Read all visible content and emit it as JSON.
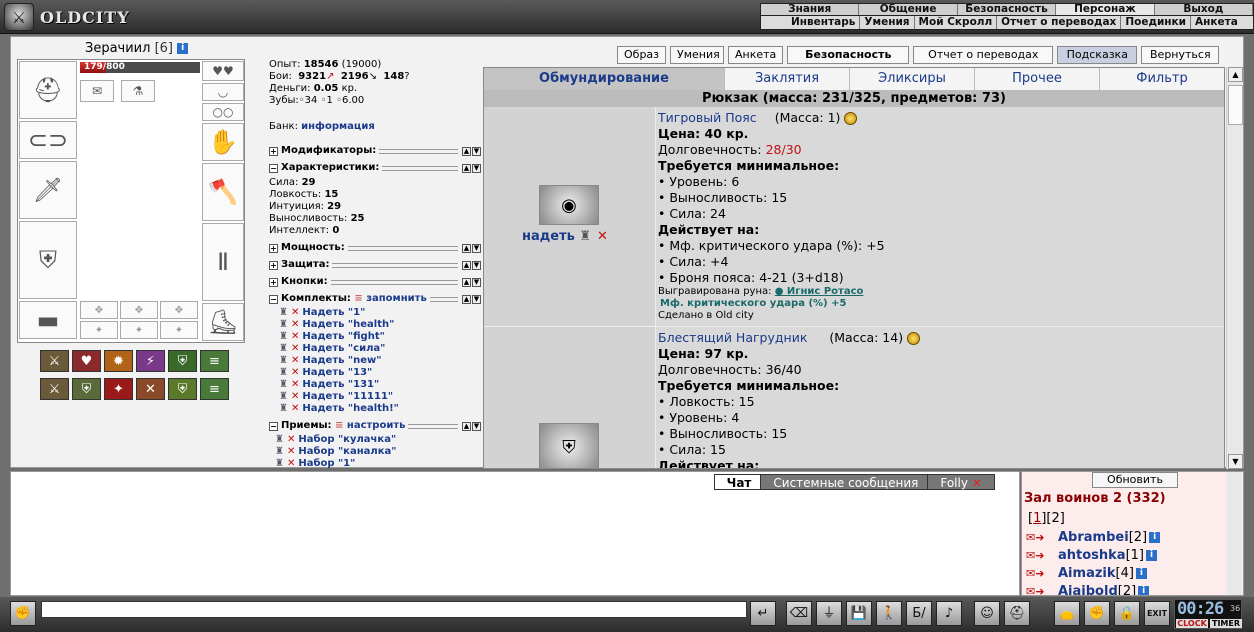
{
  "header": {
    "logo_text": "OLDCITY",
    "menu_main": [
      "Знания",
      "Общение",
      "Безопасность",
      "Персонаж",
      "Выход"
    ],
    "menu_sub": [
      "Инвентарь",
      "Умения",
      "Мой Скролл",
      "Отчет о переводах",
      "Поединки",
      "Анкета"
    ]
  },
  "character": {
    "name": "Зерачиил",
    "level": "[6]",
    "hp": "179/800",
    "hp_fraction": 0.22
  },
  "stats": {
    "exp_label": "Опыт:",
    "exp_value": "18546",
    "exp_next": "(19000)",
    "fights_label": "Бои:",
    "fights_won": "9321",
    "fights_lost": "2196",
    "fights_draw": "148",
    "money_label": "Деньги:",
    "money_value": "0.05",
    "money_unit": "кр.",
    "teeth_label": "Зубы:",
    "teeth_a": "34",
    "teeth_b": "1",
    "teeth_c": "6.00",
    "bank_label": "Банк:",
    "bank_link": "информация",
    "sec_modifiers": "Модификаторы:",
    "sec_characteristics": "Характеристики:",
    "strength_label": "Сила:",
    "strength": "29",
    "agility_label": "Ловкость:",
    "agility": "15",
    "intuition_label": "Интуиция:",
    "intuition": "29",
    "stamina_label": "Выносливость:",
    "stamina": "25",
    "intellect_label": "Интеллект:",
    "intellect": "0",
    "sec_power": "Мощность:",
    "sec_defense": "Защита:",
    "sec_buttons": "Кнопки:",
    "sec_sets": "Комплекты:",
    "remember": "запомнить",
    "sets": [
      "Надеть \"1\"",
      "Надеть \"health\"",
      "Надеть \"fight\"",
      "Надеть \"сила\"",
      "Надеть \"new\"",
      "Надеть \"13\"",
      "Надеть \"131\"",
      "Надеть \"11111\"",
      "Надеть \"health!\""
    ],
    "sec_techniques": "Приемы:",
    "configure": "настроить",
    "techniques": [
      "Набор \"кулачка\"",
      "Набор \"каналка\"",
      "Набор \"1\""
    ]
  },
  "buttons": [
    "Образ",
    "Умения",
    "Анкета",
    "Безопасность",
    "Отчет о переводах",
    "Подсказка",
    "Вернуться"
  ],
  "inventory": {
    "tabs": [
      "Обмундирование",
      "Заклятия",
      "Эликсиры",
      "Прочее",
      "Фильтр"
    ],
    "backpack": "Рюкзак (масса: 231/325, предметов: 73)",
    "wear_label": "надеть",
    "items": [
      {
        "name": "Тигровый Пояс",
        "mass": "(Масса: 1)",
        "price": "Цена: 40 кр.",
        "durability_label": "Долговечность:",
        "durability": "28/30",
        "req_title": "Требуется минимальное:",
        "reqs": [
          "• Уровень: 6",
          "• Выносливость: 15",
          "• Сила: 24"
        ],
        "eff_title": "Действует на:",
        "effects": [
          "• Мф. критического удара (%): +5",
          "• Сила: +4",
          "• Броня пояса: 4-21 (3+d18)"
        ],
        "rune_label": "Выгравирована руна:",
        "rune_name": "● Игнис Ротасо",
        "rune_effect": "Мф. критического удара (%) +5",
        "made_in": "Сделано в Old city"
      },
      {
        "name": "Блестящий Нагрудник",
        "mass": "(Масса: 14)",
        "price": "Цена: 97 кр.",
        "durability_label": "Долговечность:",
        "durability": "36/40",
        "req_title": "Требуется минимальное:",
        "reqs": [
          "• Ловкость: 15",
          "• Уровень: 4",
          "• Выносливость: 15",
          "• Сила: 15"
        ],
        "eff_title": "Действует на:"
      }
    ]
  },
  "chat": {
    "tabs": [
      "Чат",
      "Системные сообщения",
      "Folly"
    ]
  },
  "online": {
    "refresh": "Обновить",
    "room": "Зал воинов 2 (332)",
    "page_current": "1",
    "page_other": "2",
    "players": [
      {
        "name": "Abrambei",
        "level": "[2]"
      },
      {
        "name": "ahtoshka",
        "level": "[1]"
      },
      {
        "name": "Aimazik",
        "level": "[4]"
      },
      {
        "name": "Ajajbold",
        "level": "[2]"
      }
    ]
  },
  "clock": {
    "time": "00:26",
    "seconds": "36",
    "clock_label": "CLOCK",
    "timer_label": "TIMER"
  },
  "colors": {
    "link": "#1a3a8a",
    "accent_red": "#c01010",
    "room_title": "#8b0000"
  }
}
